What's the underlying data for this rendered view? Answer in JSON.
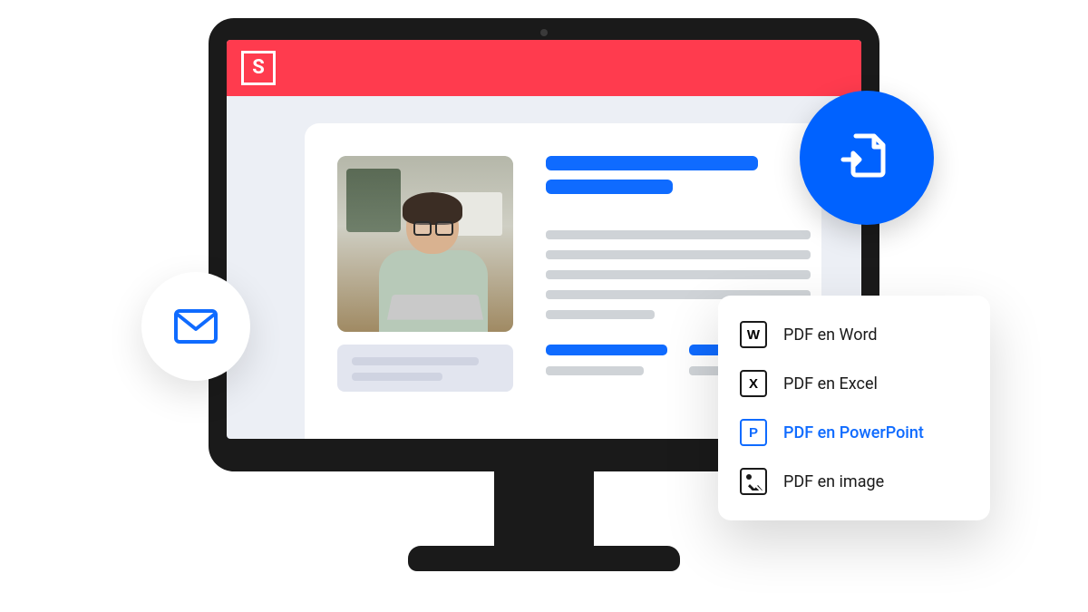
{
  "app": {
    "logo_letter": "S"
  },
  "badges": {
    "mail_icon": "mail-icon",
    "convert_icon": "convert-icon"
  },
  "convert_menu": {
    "items": [
      {
        "letter": "W",
        "label": "PDF en Word",
        "selected": false,
        "type": "letter"
      },
      {
        "letter": "X",
        "label": "PDF en Excel",
        "selected": false,
        "type": "letter"
      },
      {
        "letter": "P",
        "label": "PDF en PowerPoint",
        "selected": true,
        "type": "letter"
      },
      {
        "letter": "",
        "label": "PDF en image",
        "selected": false,
        "type": "image"
      }
    ]
  }
}
